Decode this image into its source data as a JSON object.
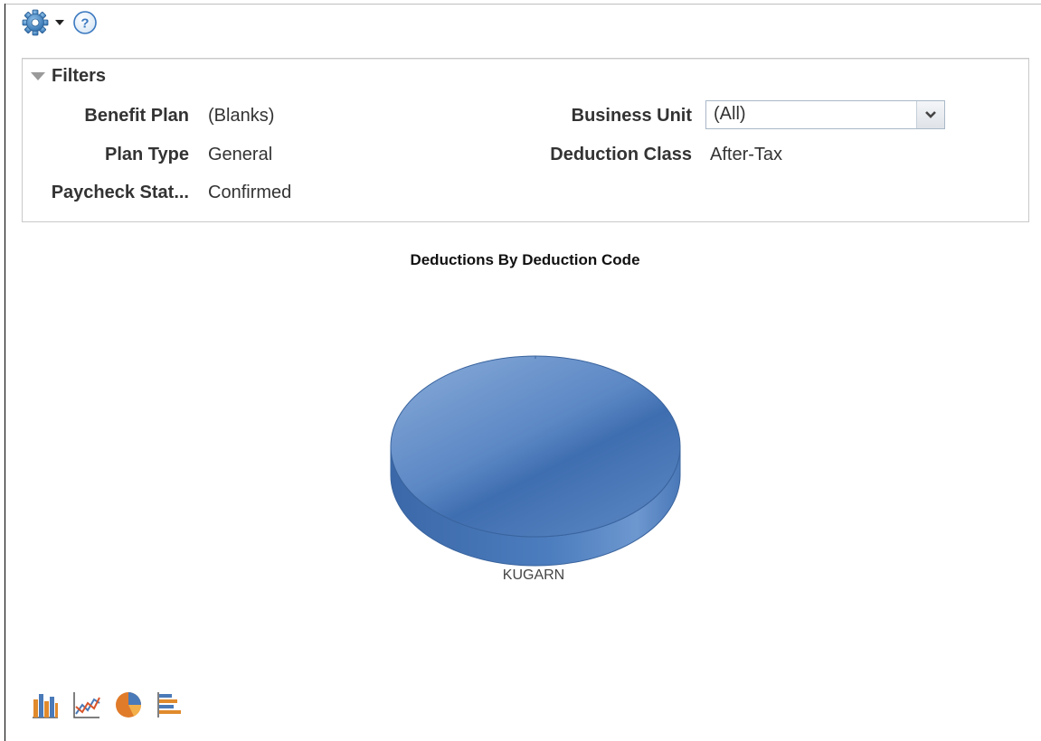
{
  "toolbar": {
    "settings_icon": "gear-icon",
    "menu_icon": "caret-down-icon",
    "help_icon": "help-icon"
  },
  "filters": {
    "title": "Filters",
    "benefit_plan": {
      "label": "Benefit Plan",
      "value": "(Blanks)"
    },
    "plan_type": {
      "label": "Plan Type",
      "value": "General"
    },
    "paycheck_status": {
      "label": "Paycheck Stat...",
      "value": "Confirmed"
    },
    "business_unit": {
      "label": "Business Unit",
      "value": "(All)"
    },
    "deduction_class": {
      "label": "Deduction Class",
      "value": "After-Tax"
    }
  },
  "chart_data": {
    "type": "pie",
    "title": "Deductions By Deduction Code",
    "categories": [
      "KUGARN"
    ],
    "values": [
      100
    ],
    "colors": [
      "#4a7ab8"
    ]
  },
  "chart_tools": [
    "bar-chart-icon",
    "line-chart-icon",
    "pie-chart-icon",
    "horizontal-bar-chart-icon"
  ]
}
